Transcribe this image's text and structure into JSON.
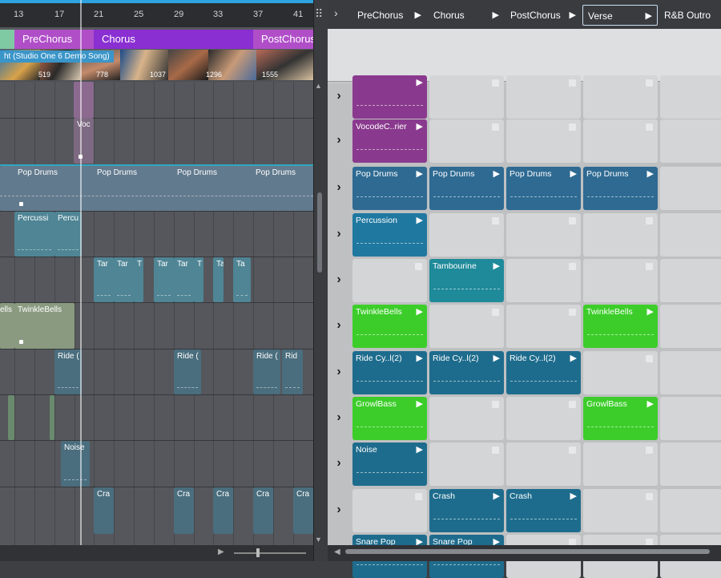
{
  "ruler": {
    "ticks": [
      "13",
      "17",
      "21",
      "25",
      "29",
      "33",
      "37",
      "41"
    ]
  },
  "arrange_markers": [
    {
      "label": "",
      "color": "#7fc9a3"
    },
    {
      "label": "PreChorus",
      "color": "#b04ec8"
    },
    {
      "label": "Chorus",
      "color": "#8a2fd1"
    },
    {
      "label": "PostChorus",
      "color": "#b04ec8"
    }
  ],
  "video": {
    "title": "ht (Studio One 6 Demo Song)",
    "frames": [
      "519",
      "778",
      "1037",
      "1296",
      "1555"
    ]
  },
  "arrange_clips": {
    "vocoder": "Voc",
    "pop_drums": [
      "Pop Drums",
      "Pop Drums",
      "Pop Drums",
      "Pop Drums"
    ],
    "percussion": [
      "Percussi",
      "Percu"
    ],
    "tambourine": [
      "Tar",
      "Tar",
      "T",
      "Tar",
      "Tar",
      "T",
      "Ta",
      "Ta"
    ],
    "twinkle": [
      "ells",
      "TwinkleBells"
    ],
    "ride": [
      "Ride (",
      "Ride (",
      "Ride (",
      "Rid"
    ],
    "noise": "Noise",
    "crash": [
      "Cra",
      "Cra",
      "Cra",
      "Cra",
      "Cra"
    ]
  },
  "scenes": [
    {
      "label": "PreChorus",
      "color": "#a840c0"
    },
    {
      "label": "Chorus",
      "color": "#8a2fd1"
    },
    {
      "label": "PostChorus",
      "color": "#a840c0"
    },
    {
      "label": "Verse",
      "color": "#3e8a5e"
    },
    {
      "label": "R&B Outro",
      "color": "#8c1d1d"
    }
  ],
  "launcher_rows": [
    {
      "clips": [
        {
          "name": "",
          "color": "#8a3a8e"
        },
        null,
        null,
        null,
        null
      ]
    },
    {
      "clips": [
        {
          "name": "VocodeC..rier",
          "color": "#8a3a8e"
        },
        null,
        null,
        null,
        null
      ]
    },
    {
      "clips": [
        {
          "name": "Pop Drums",
          "color": "#2e6a92"
        },
        {
          "name": "Pop Drums",
          "color": "#2e6a92"
        },
        {
          "name": "Pop Drums",
          "color": "#2e6a92"
        },
        {
          "name": "Pop Drums",
          "color": "#2e6a92"
        },
        null
      ]
    },
    {
      "clips": [
        {
          "name": "Percussion",
          "color": "#1f78a0"
        },
        null,
        null,
        null,
        null
      ]
    },
    {
      "clips": [
        null,
        {
          "name": "Tambourine",
          "color": "#1f8a9a"
        },
        null,
        null,
        null
      ]
    },
    {
      "clips": [
        {
          "name": "TwinkleBells",
          "color": "#3ccd2a"
        },
        null,
        null,
        {
          "name": "TwinkleBells",
          "color": "#3ccd2a"
        },
        null
      ]
    },
    {
      "clips": [
        {
          "name": "Ride Cy..l(2)",
          "color": "#1e6c8d"
        },
        {
          "name": "Ride Cy..l(2)",
          "color": "#1e6c8d"
        },
        {
          "name": "Ride Cy..l(2)",
          "color": "#1e6c8d"
        },
        null,
        null
      ]
    },
    {
      "clips": [
        {
          "name": "GrowlBass",
          "color": "#3ccd2a"
        },
        null,
        null,
        {
          "name": "GrowlBass",
          "color": "#3ccd2a"
        },
        null
      ]
    },
    {
      "clips": [
        {
          "name": "Noise",
          "color": "#1e6c8d"
        },
        null,
        null,
        null,
        null
      ]
    },
    {
      "clips": [
        null,
        {
          "name": "Crash",
          "color": "#1e6c8d"
        },
        {
          "name": "Crash",
          "color": "#1e6c8d"
        },
        null,
        null
      ]
    },
    {
      "clips": [
        {
          "name": "Snare Pop",
          "color": "#1e6c8d"
        },
        {
          "name": "Snare Pop",
          "color": "#1e6c8d"
        },
        null,
        null,
        null
      ]
    }
  ],
  "icons": {
    "row_expand": "chevron-right-icon",
    "play": "play-triangle-icon"
  }
}
